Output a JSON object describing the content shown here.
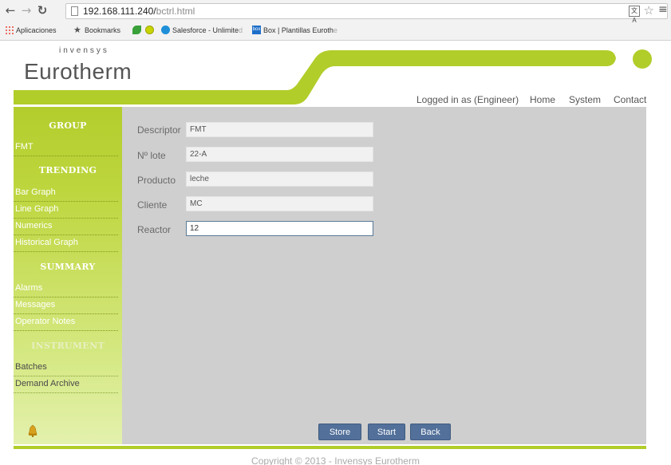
{
  "browser": {
    "url_host": "192.168.111.240/",
    "url_path": "bctrl.html",
    "bookmarks": {
      "apps": "Aplicaciones",
      "bookmarks": "Bookmarks",
      "salesforce": "Salesforce - Unlimite",
      "salesforce_fade": "d",
      "box": "Box | Plantillas Euroth",
      "box_fade": "e",
      "box_icon_text": "box"
    },
    "translate_icon_text": "文A"
  },
  "header": {
    "brand_small": "invensys",
    "brand_big": "Eurotherm",
    "logged_in": "Logged in as (Engineer)",
    "nav": [
      "Home",
      "System",
      "Contact"
    ]
  },
  "sidebar": {
    "group_title": "GROUP",
    "group_items": [
      "FMT"
    ],
    "trending_title": "TRENDING",
    "trending_items": [
      "Bar Graph",
      "Line Graph",
      "Numerics",
      "Historical Graph"
    ],
    "summary_title": "SUMMARY",
    "summary_items": [
      "Alarms",
      "Messages",
      "Operator Notes"
    ],
    "instrument_title": "INSTRUMENT",
    "instrument_items": [
      "Batches",
      "Demand Archive"
    ]
  },
  "form": {
    "fields": [
      {
        "label": "Descriptor",
        "value": "FMT"
      },
      {
        "label": "Nº lote",
        "value": "22-A"
      },
      {
        "label": "Producto",
        "value": "leche"
      },
      {
        "label": "Cliente",
        "value": "MC"
      },
      {
        "label": "Reactor",
        "value": "12"
      }
    ]
  },
  "buttons": {
    "store": "Store",
    "start": "Start",
    "back": "Back"
  },
  "footer": {
    "copyright": "Copyright © 2013 - Invensys Eurotherm"
  },
  "colors": {
    "accent_green": "#b1cd2a",
    "content_gray": "#cfcfcf",
    "button_blue": "#52709a"
  }
}
